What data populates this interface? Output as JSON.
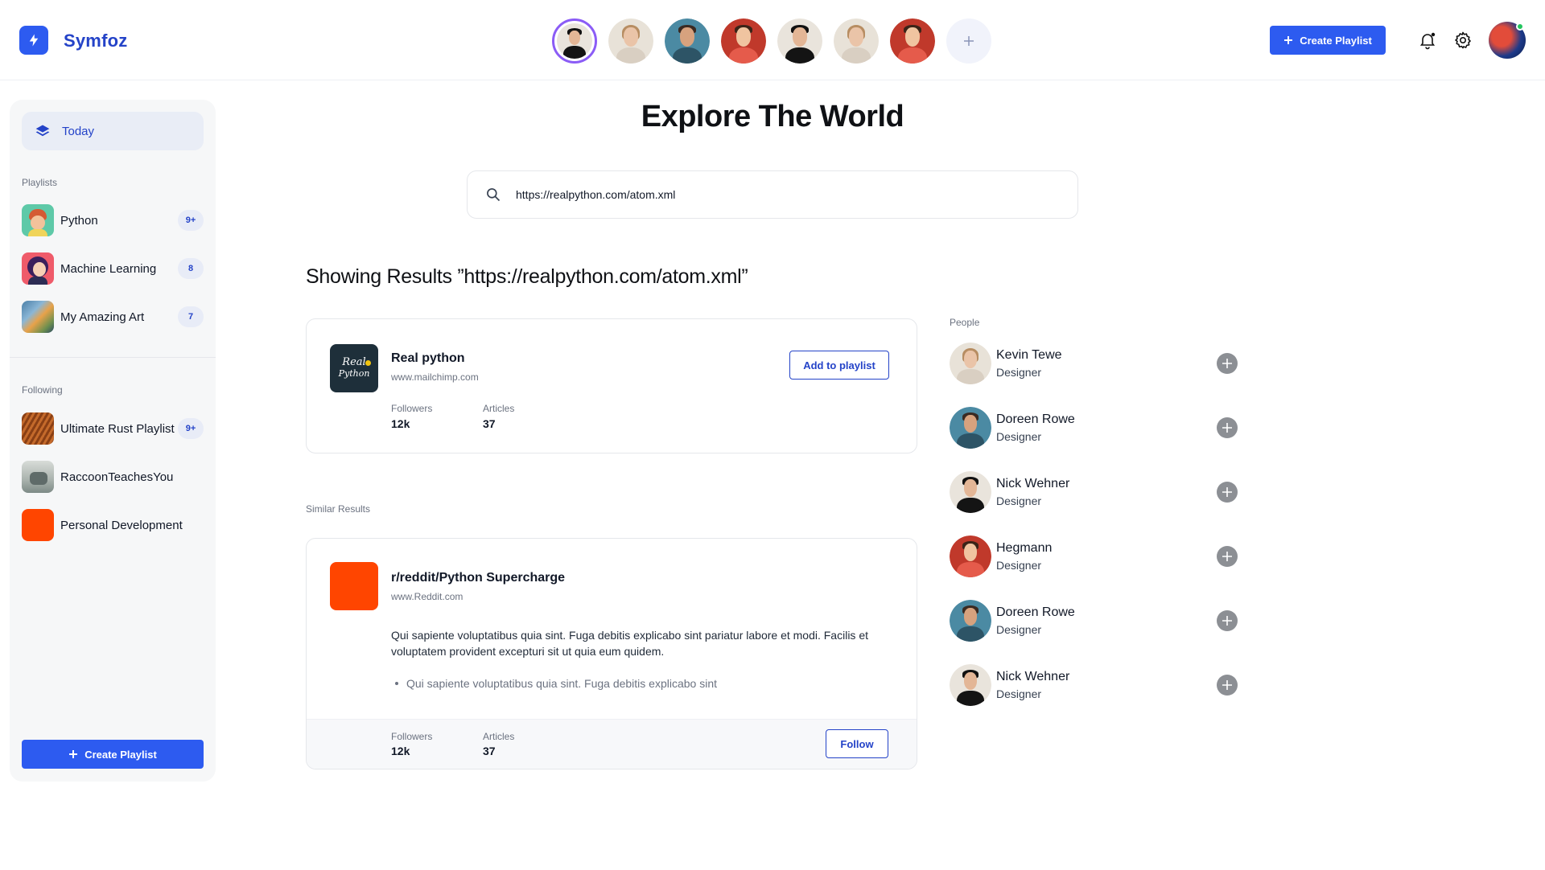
{
  "header": {
    "brand": "Symfoz",
    "create_playlist": "Create Playlist",
    "stories": [
      {
        "name": "man-dark-hair",
        "active": true
      },
      {
        "name": "woman-light-hair"
      },
      {
        "name": "man-teal-bg"
      },
      {
        "name": "person-red-watermelon"
      },
      {
        "name": "man-dark-hair"
      },
      {
        "name": "woman-light-hair"
      },
      {
        "name": "person-red-watermelon"
      }
    ],
    "add_icon": "plus-icon"
  },
  "sidebar": {
    "today": "Today",
    "playlists_heading": "Playlists",
    "playlists": [
      {
        "label": "Python",
        "badge": "9+"
      },
      {
        "label": "Machine Learning",
        "badge": "8"
      },
      {
        "label": "My Amazing Art",
        "badge": "7"
      }
    ],
    "following_heading": "Following",
    "following": [
      {
        "label": "Ultimate Rust Playlist",
        "badge": "9+"
      },
      {
        "label": "RaccoonTeachesYou"
      },
      {
        "label": "Personal Development"
      }
    ],
    "create_playlist": "Create Playlist"
  },
  "main": {
    "title": "Explore The World",
    "search_value": "https://realpython.com/atom.xml",
    "results_heading": "Showing Results ”https://realpython.com/atom.xml”",
    "top_result": {
      "name": "Real python",
      "url": "www.mailchimp.com",
      "logo_text_1": "Real",
      "logo_text_2": "Python",
      "followers_label": "Followers",
      "followers": "12k",
      "articles_label": "Articles",
      "articles": "37",
      "button": "Add to playlist"
    },
    "similar_label": "Similar Results",
    "similar": {
      "name": "r/reddit/Python Supercharge",
      "url": "www.Reddit.com",
      "description": "Qui sapiente voluptatibus quia sint. Fuga debitis explicabo sint pariatur labore et modi. Facilis et voluptatem provident excepturi sit ut quia eum quidem.",
      "bullet": "Qui sapiente voluptatibus quia sint. Fuga debitis explicabo sint",
      "followers_label": "Followers",
      "followers": "12k",
      "articles_label": "Articles",
      "articles": "37",
      "button": "Follow"
    }
  },
  "people": {
    "heading": "People",
    "list": [
      {
        "name": "Kevin Tewe",
        "role": "Designer"
      },
      {
        "name": "Doreen Rowe",
        "role": "Designer"
      },
      {
        "name": "Nick Wehner",
        "role": "Designer"
      },
      {
        "name": "Hegmann",
        "role": "Designer"
      },
      {
        "name": "Doreen Rowe",
        "role": "Designer"
      },
      {
        "name": "Nick Wehner",
        "role": "Designer"
      }
    ]
  },
  "colors": {
    "accent": "#2d5bf0",
    "brand_text": "#2443c8",
    "story_ring": "#8b5cf6",
    "reddit_orange": "#ff4500",
    "realpython_bg": "#1e2f3a"
  }
}
